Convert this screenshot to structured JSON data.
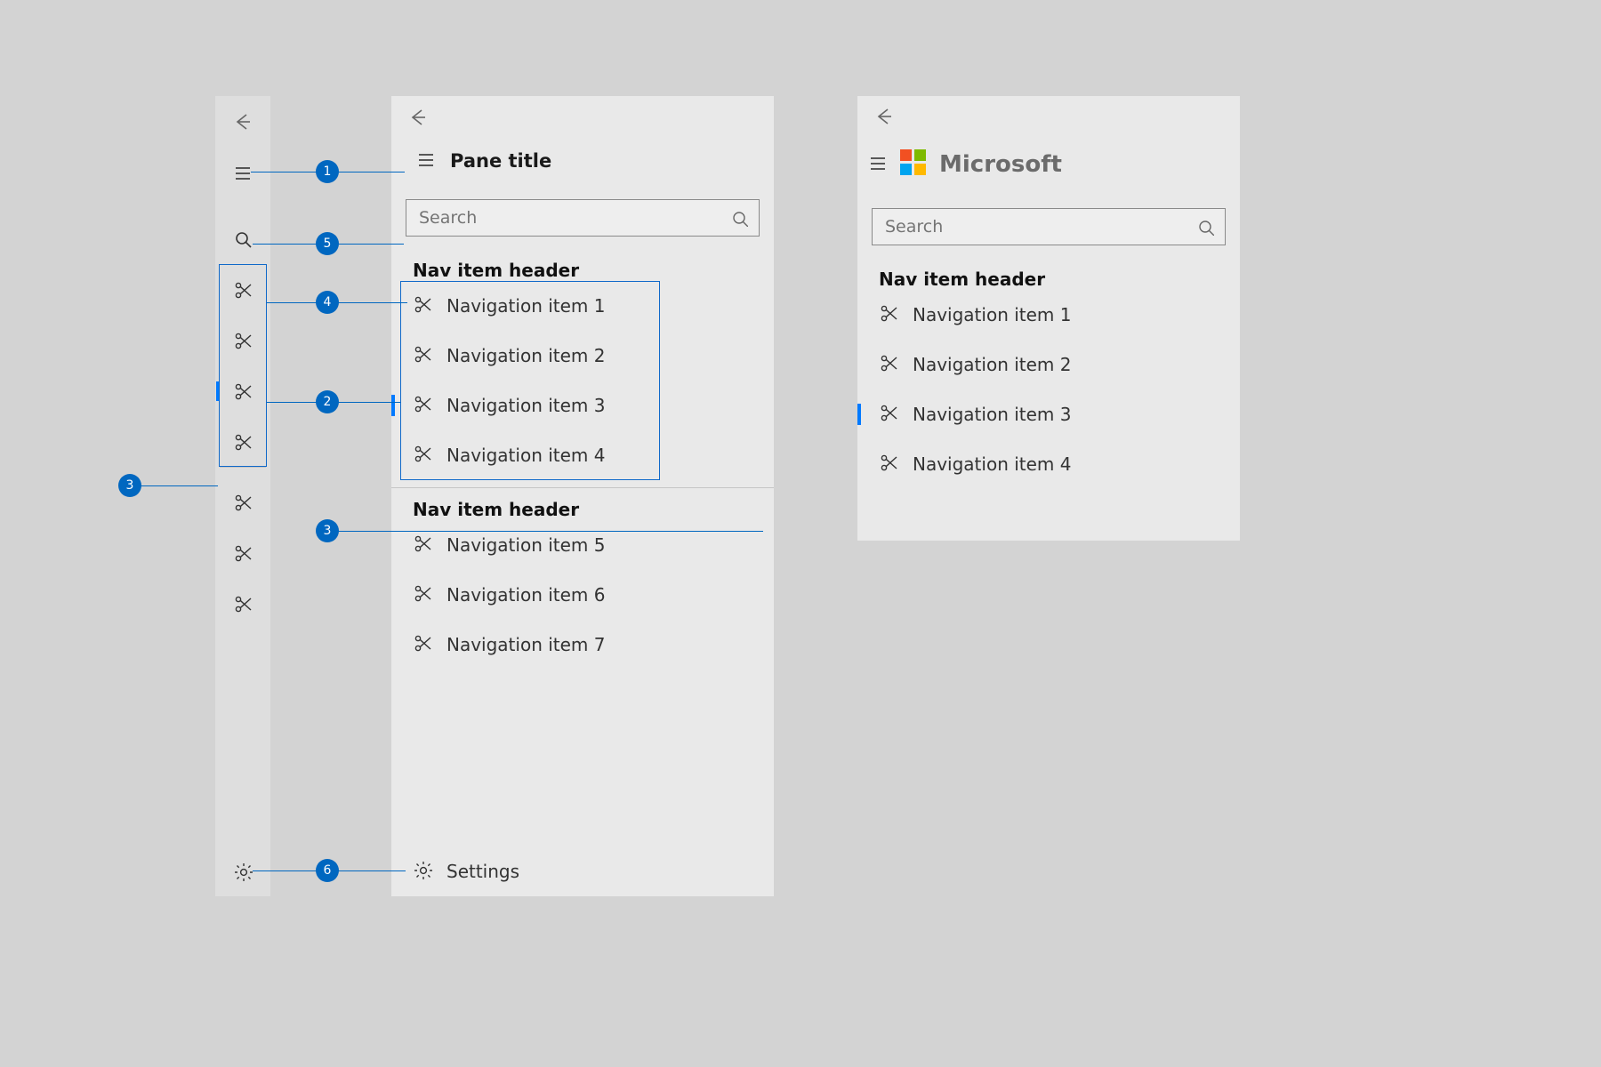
{
  "colors": {
    "accent": "#0067c0",
    "nav_select": "#007aff"
  },
  "compact": {
    "ms_logo_colors": [
      "#f25022",
      "#7fba00",
      "#00a4ef",
      "#ffb900"
    ]
  },
  "expanded": {
    "pane_title": "Pane title",
    "search_placeholder": "Search",
    "section1_header": "Nav item header",
    "section1_items": [
      "Navigation item 1",
      "Navigation item 2",
      "Navigation item 3",
      "Navigation item 4"
    ],
    "section1_selected_index": 2,
    "section2_header": "Nav item header",
    "section2_items": [
      "Navigation item 5",
      "Navigation item 6",
      "Navigation item 7"
    ],
    "footer_settings": "Settings"
  },
  "branded": {
    "brand_text": "Microsoft",
    "search_placeholder": "Search",
    "section_header": "Nav item header",
    "items": [
      "Navigation item 1",
      "Navigation item 2",
      "Navigation item 3",
      "Navigation item 4"
    ],
    "selected_index": 2
  },
  "callouts": {
    "c1": "1",
    "c2": "2",
    "c3": "3",
    "c3b": "3",
    "c4": "4",
    "c5": "5",
    "c6": "6"
  }
}
